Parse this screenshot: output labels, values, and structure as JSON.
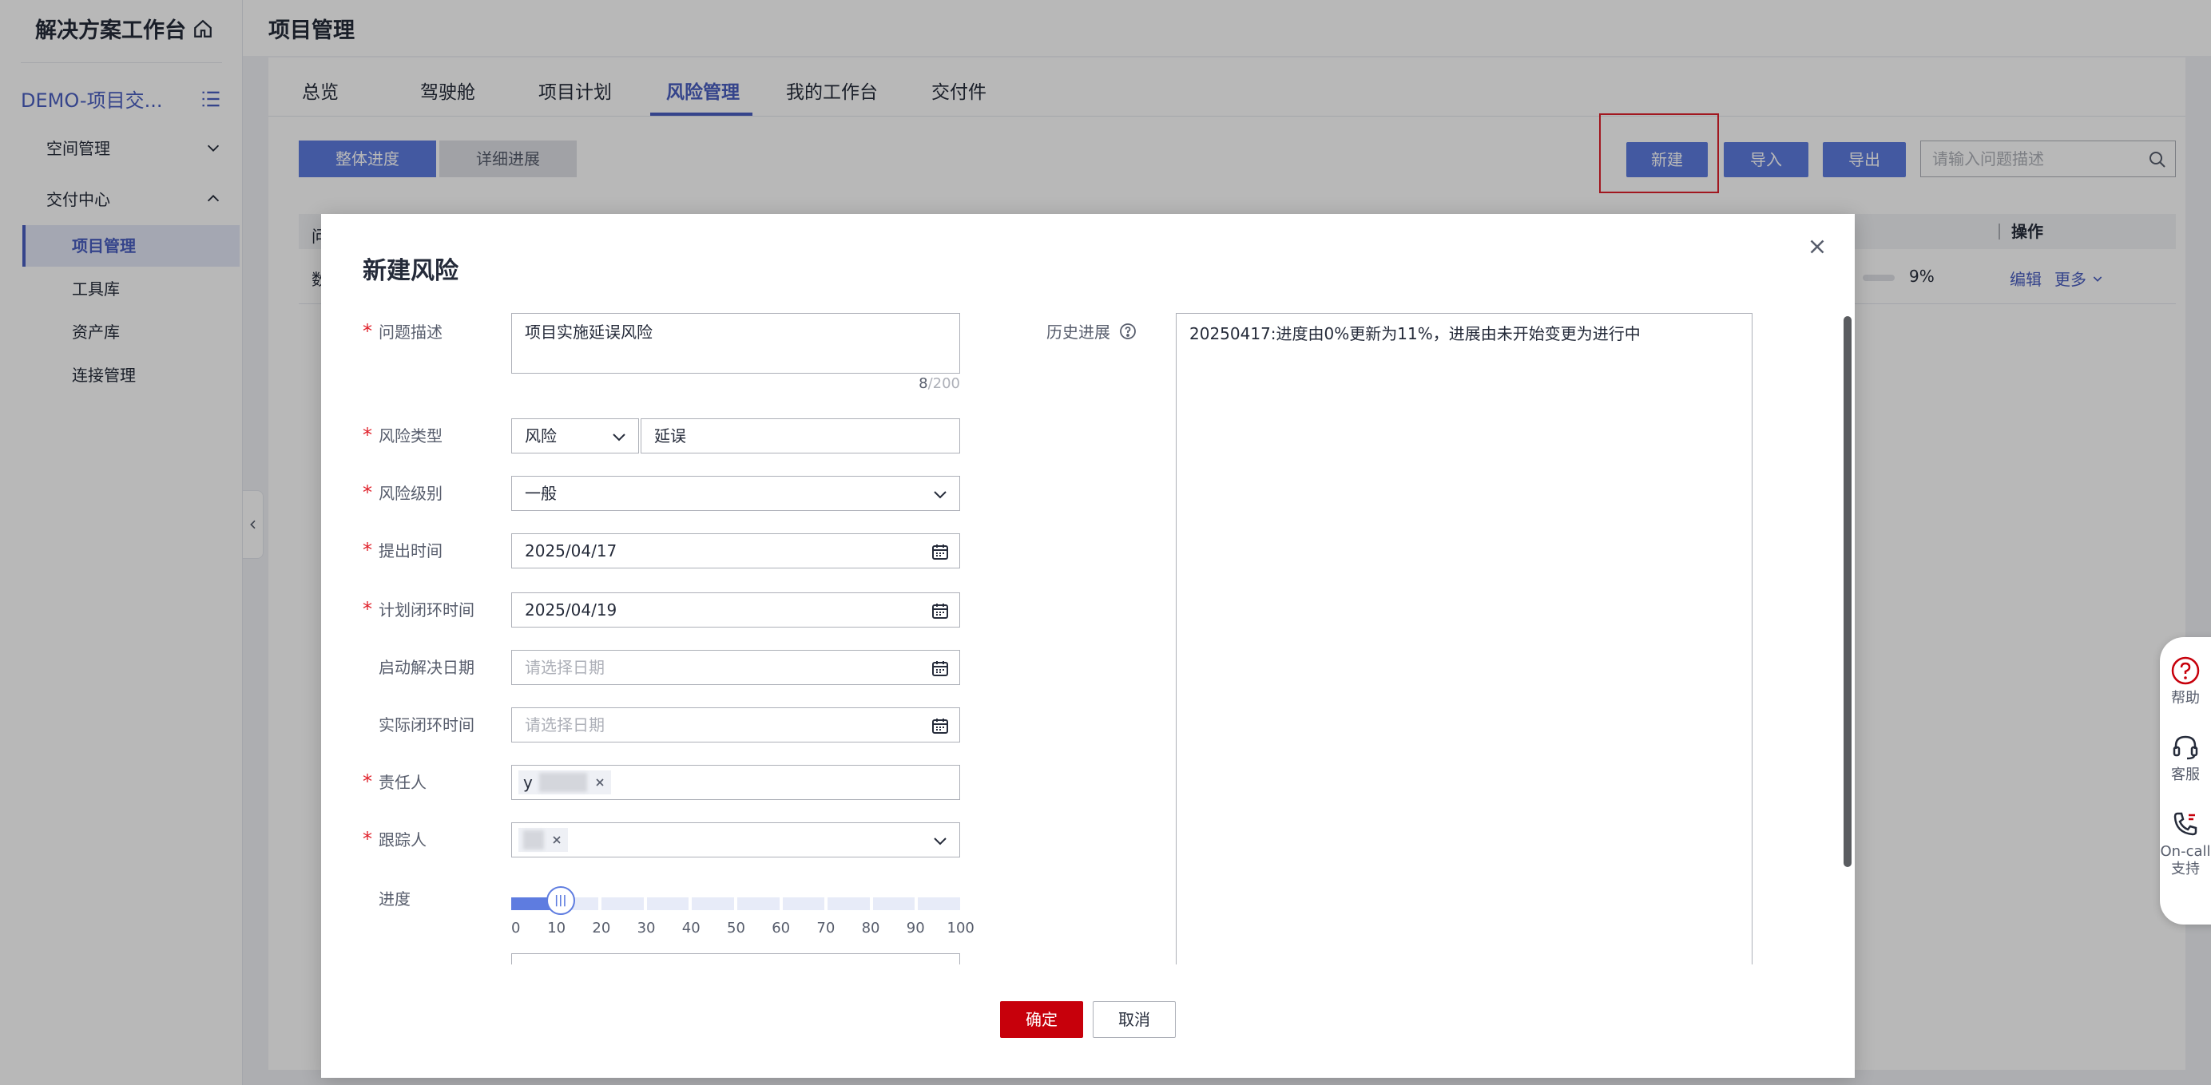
{
  "sidebar": {
    "logo": "解决方案工作台",
    "project": "DEMO-项目交...",
    "groups": [
      {
        "label": "空间管理"
      },
      {
        "label": "交付中心"
      }
    ],
    "items": [
      {
        "label": "项目管理"
      },
      {
        "label": "工具库"
      },
      {
        "label": "资产库"
      },
      {
        "label": "连接管理"
      }
    ]
  },
  "header": {
    "title": "项目管理"
  },
  "tabs": [
    {
      "label": "总览"
    },
    {
      "label": "驾驶舱"
    },
    {
      "label": "项目计划"
    },
    {
      "label": "风险管理"
    },
    {
      "label": "我的工作台"
    },
    {
      "label": "交付件"
    }
  ],
  "toolbar": {
    "seg_overall": "整体进度",
    "seg_detail": "详细进展",
    "new": "新建",
    "import": "导入",
    "export": "导出",
    "search_placeholder": "请输入问题描述"
  },
  "table": {
    "col_first": "问",
    "col_op": "操作",
    "row": {
      "first_char": "数",
      "pct": "9%",
      "edit": "编辑",
      "more": "更多"
    }
  },
  "modal": {
    "title": "新建风险",
    "fields": {
      "desc_label": "问题描述",
      "desc_value": "项目实施延误风险",
      "desc_count": "8",
      "desc_max": "/200",
      "type_label": "风险类型",
      "type_select": "风险",
      "type_value": "延误",
      "level_label": "风险级别",
      "level_value": "一般",
      "raise_label": "提出时间",
      "raise_value": "2025/04/17",
      "plan_close_label": "计划闭环时间",
      "plan_close_value": "2025/04/19",
      "start_label": "启动解决日期",
      "start_placeholder": "请选择日期",
      "actual_label": "实际闭环时间",
      "actual_placeholder": "请选择日期",
      "owner_label": "责任人",
      "owner_initial": "y",
      "tracker_label": "跟踪人",
      "progress_label": "进度",
      "progress_ticks": [
        "0",
        "10",
        "20",
        "30",
        "40",
        "50",
        "60",
        "70",
        "80",
        "90",
        "100"
      ]
    },
    "history_label": "历史进展",
    "history_text": "20250417:进度由0%更新为11%，进展由未开始变更为进行中",
    "ok": "确定",
    "cancel": "取消"
  },
  "float_help": {
    "help": "帮助",
    "service": "客服",
    "oncall": "On-call支持"
  },
  "colors": {
    "primary": "#5e7ce0",
    "danger": "#c7000b",
    "highlight": "#e0212b"
  },
  "progress_value": 11
}
